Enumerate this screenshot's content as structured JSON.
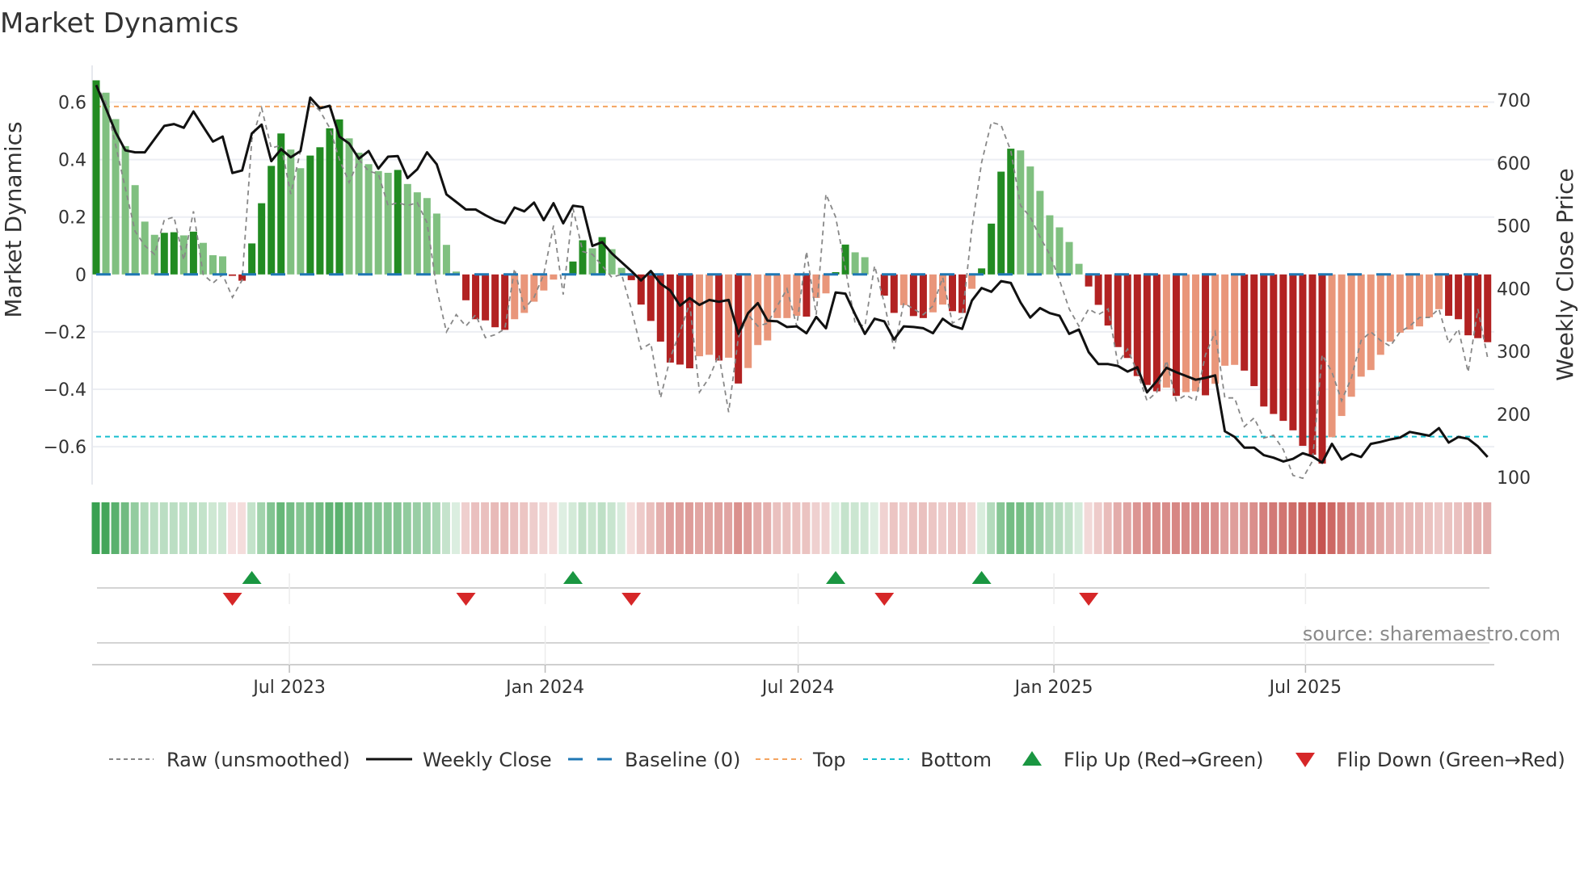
{
  "chart_data": {
    "type": "bar",
    "title": "Market Dynamics",
    "ylabel": "Market Dynamics",
    "ylabel_right": "Weekly Close Price",
    "ylim": [
      -0.72,
      0.72
    ],
    "ylim_right": [
      80,
      720
    ],
    "yticks": [
      "0.6",
      "0.4",
      "0.2",
      "0",
      "−0.2",
      "−0.4",
      "−0.6"
    ],
    "yticks_values": [
      0.6,
      0.4,
      0.2,
      0,
      -0.2,
      -0.4,
      -0.6
    ],
    "yticks_right": [
      "700",
      "600",
      "500",
      "400",
      "300",
      "200",
      "100"
    ],
    "yticks_right_values": [
      700,
      600,
      500,
      400,
      300,
      200,
      100
    ],
    "xticks": [
      "Jul 2023",
      "Jan 2024",
      "Jul 2024",
      "Jan 2025",
      "Jul 2025"
    ],
    "xticks_dates": [
      "2023-07-01",
      "2024-01-01",
      "2024-07-01",
      "2025-01-01",
      "2025-07-01"
    ],
    "start_date": "2023-02-12",
    "frequency": "weekly",
    "top_level": 0.585,
    "bottom_level": -0.565,
    "baseline": 0,
    "values": [
      0.676,
      0.633,
      0.541,
      0.447,
      0.311,
      0.184,
      0.138,
      0.145,
      0.147,
      0.136,
      0.149,
      0.11,
      0.067,
      0.063,
      -0.005,
      -0.022,
      0.108,
      0.248,
      0.378,
      0.491,
      0.435,
      0.37,
      0.414,
      0.443,
      0.509,
      0.54,
      0.474,
      0.424,
      0.384,
      0.36,
      0.354,
      0.364,
      0.315,
      0.286,
      0.266,
      0.212,
      0.103,
      0.01,
      -0.09,
      -0.156,
      -0.16,
      -0.184,
      -0.193,
      -0.156,
      -0.134,
      -0.095,
      -0.056,
      -0.018,
      0.0,
      0.045,
      0.119,
      0.091,
      0.13,
      0.088,
      0.023,
      -0.02,
      -0.105,
      -0.162,
      -0.234,
      -0.307,
      -0.314,
      -0.327,
      -0.285,
      -0.28,
      -0.3,
      -0.29,
      -0.38,
      -0.326,
      -0.246,
      -0.23,
      -0.152,
      -0.152,
      -0.144,
      -0.147,
      -0.082,
      -0.066,
      0.008,
      0.104,
      0.077,
      0.06,
      0.0,
      -0.074,
      -0.134,
      -0.107,
      -0.145,
      -0.152,
      -0.132,
      -0.105,
      -0.128,
      -0.134,
      -0.05,
      0.021,
      0.177,
      0.358,
      0.438,
      0.432,
      0.376,
      0.291,
      0.206,
      0.164,
      0.113,
      0.037,
      -0.042,
      -0.106,
      -0.178,
      -0.253,
      -0.291,
      -0.354,
      -0.385,
      -0.407,
      -0.394,
      -0.423,
      -0.41,
      -0.407,
      -0.421,
      -0.381,
      -0.318,
      -0.315,
      -0.335,
      -0.389,
      -0.46,
      -0.486,
      -0.51,
      -0.543,
      -0.597,
      -0.628,
      -0.659,
      -0.567,
      -0.493,
      -0.426,
      -0.356,
      -0.333,
      -0.28,
      -0.234,
      -0.203,
      -0.192,
      -0.181,
      -0.149,
      -0.121,
      -0.144,
      -0.156,
      -0.212,
      -0.222,
      -0.236
    ],
    "strong": [
      1,
      0,
      0,
      0,
      0,
      0,
      0,
      1,
      1,
      0,
      1,
      0,
      0,
      0,
      1,
      1,
      1,
      1,
      1,
      1,
      0,
      0,
      1,
      1,
      1,
      1,
      0,
      0,
      0,
      0,
      0,
      1,
      0,
      0,
      0,
      0,
      0,
      0,
      1,
      1,
      1,
      1,
      1,
      0,
      0,
      0,
      0,
      0,
      0,
      1,
      1,
      0,
      1,
      0,
      0,
      1,
      1,
      1,
      1,
      1,
      1,
      1,
      0,
      0,
      1,
      0,
      1,
      0,
      0,
      0,
      0,
      0,
      0,
      1,
      0,
      0,
      1,
      1,
      0,
      0,
      0,
      1,
      1,
      0,
      1,
      1,
      0,
      0,
      1,
      1,
      0,
      1,
      1,
      1,
      1,
      0,
      0,
      0,
      0,
      0,
      0,
      0,
      1,
      1,
      1,
      1,
      1,
      1,
      1,
      1,
      0,
      1,
      0,
      0,
      1,
      0,
      0,
      0,
      1,
      1,
      1,
      1,
      1,
      1,
      1,
      1,
      1,
      0,
      0,
      0,
      0,
      0,
      0,
      0,
      0,
      0,
      0,
      0,
      0,
      1,
      1,
      1,
      1,
      1
    ],
    "raw": [
      0.66,
      0.6,
      0.45,
      0.3,
      0.15,
      0.1,
      0.07,
      0.19,
      0.2,
      0.05,
      0.22,
      0.0,
      -0.03,
      0.0,
      -0.08,
      -0.02,
      0.47,
      0.58,
      0.44,
      0.45,
      0.28,
      0.43,
      0.6,
      0.57,
      0.51,
      0.4,
      0.32,
      0.4,
      0.36,
      0.35,
      0.24,
      0.25,
      0.24,
      0.25,
      0.18,
      -0.05,
      -0.2,
      -0.14,
      -0.18,
      -0.14,
      -0.22,
      -0.21,
      -0.19,
      0.02,
      -0.12,
      -0.08,
      0.0,
      0.17,
      -0.07,
      0.23,
      0.08,
      0.07,
      0.03,
      -0.01,
      0.0,
      -0.12,
      -0.26,
      -0.24,
      -0.43,
      -0.29,
      -0.2,
      -0.1,
      -0.41,
      -0.36,
      -0.28,
      -0.48,
      -0.22,
      -0.14,
      -0.18,
      -0.17,
      -0.11,
      -0.05,
      -0.18,
      0.08,
      -0.14,
      0.28,
      0.2,
      0.02,
      -0.17,
      -0.18,
      0.03,
      -0.1,
      -0.26,
      -0.1,
      -0.12,
      -0.14,
      -0.11,
      -0.01,
      -0.17,
      -0.15,
      0.16,
      0.39,
      0.53,
      0.52,
      0.43,
      0.24,
      0.2,
      0.13,
      0.07,
      -0.02,
      -0.12,
      -0.18,
      -0.12,
      -0.14,
      -0.12,
      -0.31,
      -0.26,
      -0.34,
      -0.44,
      -0.41,
      -0.3,
      -0.44,
      -0.42,
      -0.44,
      -0.28,
      -0.2,
      -0.43,
      -0.43,
      -0.53,
      -0.5,
      -0.57,
      -0.56,
      -0.61,
      -0.7,
      -0.71,
      -0.65,
      -0.28,
      -0.34,
      -0.44,
      -0.36,
      -0.23,
      -0.2,
      -0.23,
      -0.25,
      -0.2,
      -0.18,
      -0.15,
      -0.15,
      -0.12,
      -0.24,
      -0.19,
      -0.34,
      -0.12,
      -0.29
    ],
    "close": [
      724,
      687,
      649,
      620,
      617,
      617,
      638,
      659,
      662,
      656,
      682,
      658,
      634,
      642,
      584,
      588,
      647,
      661,
      603,
      622,
      609,
      619,
      704,
      687,
      691,
      642,
      631,
      607,
      619,
      591,
      610,
      611,
      576,
      590,
      617,
      598,
      550,
      538,
      526,
      526,
      517,
      509,
      504,
      529,
      523,
      537,
      509,
      536,
      504,
      532,
      530,
      468,
      474,
      456,
      442,
      428,
      413,
      428,
      408,
      397,
      373,
      385,
      374,
      382,
      379,
      382,
      328,
      361,
      377,
      349,
      348,
      339,
      340,
      329,
      355,
      337,
      394,
      392,
      359,
      328,
      352,
      348,
      319,
      340,
      339,
      337,
      329,
      352,
      341,
      336,
      381,
      401,
      395,
      412,
      409,
      378,
      354,
      369,
      361,
      357,
      328,
      335,
      299,
      280,
      280,
      277,
      268,
      275,
      235,
      253,
      274,
      267,
      261,
      255,
      258,
      262,
      173,
      164,
      147,
      147,
      135,
      131,
      125,
      129,
      138,
      133,
      123,
      153,
      128,
      137,
      132,
      153,
      156,
      160,
      163,
      172,
      169,
      166,
      178,
      155,
      164,
      161,
      149,
      132
    ],
    "flip_up_dates": [
      "2023-06-04",
      "2024-01-21",
      "2024-07-28",
      "2024-11-10"
    ],
    "flip_down_dates": [
      "2023-05-21",
      "2023-11-05",
      "2024-03-03",
      "2024-09-01",
      "2025-01-26"
    ],
    "colors": {
      "strong_up": "#228b22",
      "weak_up": "#80c080",
      "strong_down": "#b22222",
      "weak_down": "#e9967a",
      "close": "#111111",
      "raw": "#888888",
      "baseline": "#1f77b4",
      "top": "#f4a460",
      "bottom": "#17becf",
      "flip_up": "#1a9641",
      "flip_down": "#d62728"
    },
    "legend": {
      "position": "bottom",
      "items": [
        "Raw (unsmoothed)",
        "Weekly Close",
        "Baseline (0)",
        "Top",
        "Bottom",
        "Flip Up (Red→Green)",
        "Flip Down (Green→Red)"
      ]
    },
    "source": "source: sharemaestro.com"
  }
}
